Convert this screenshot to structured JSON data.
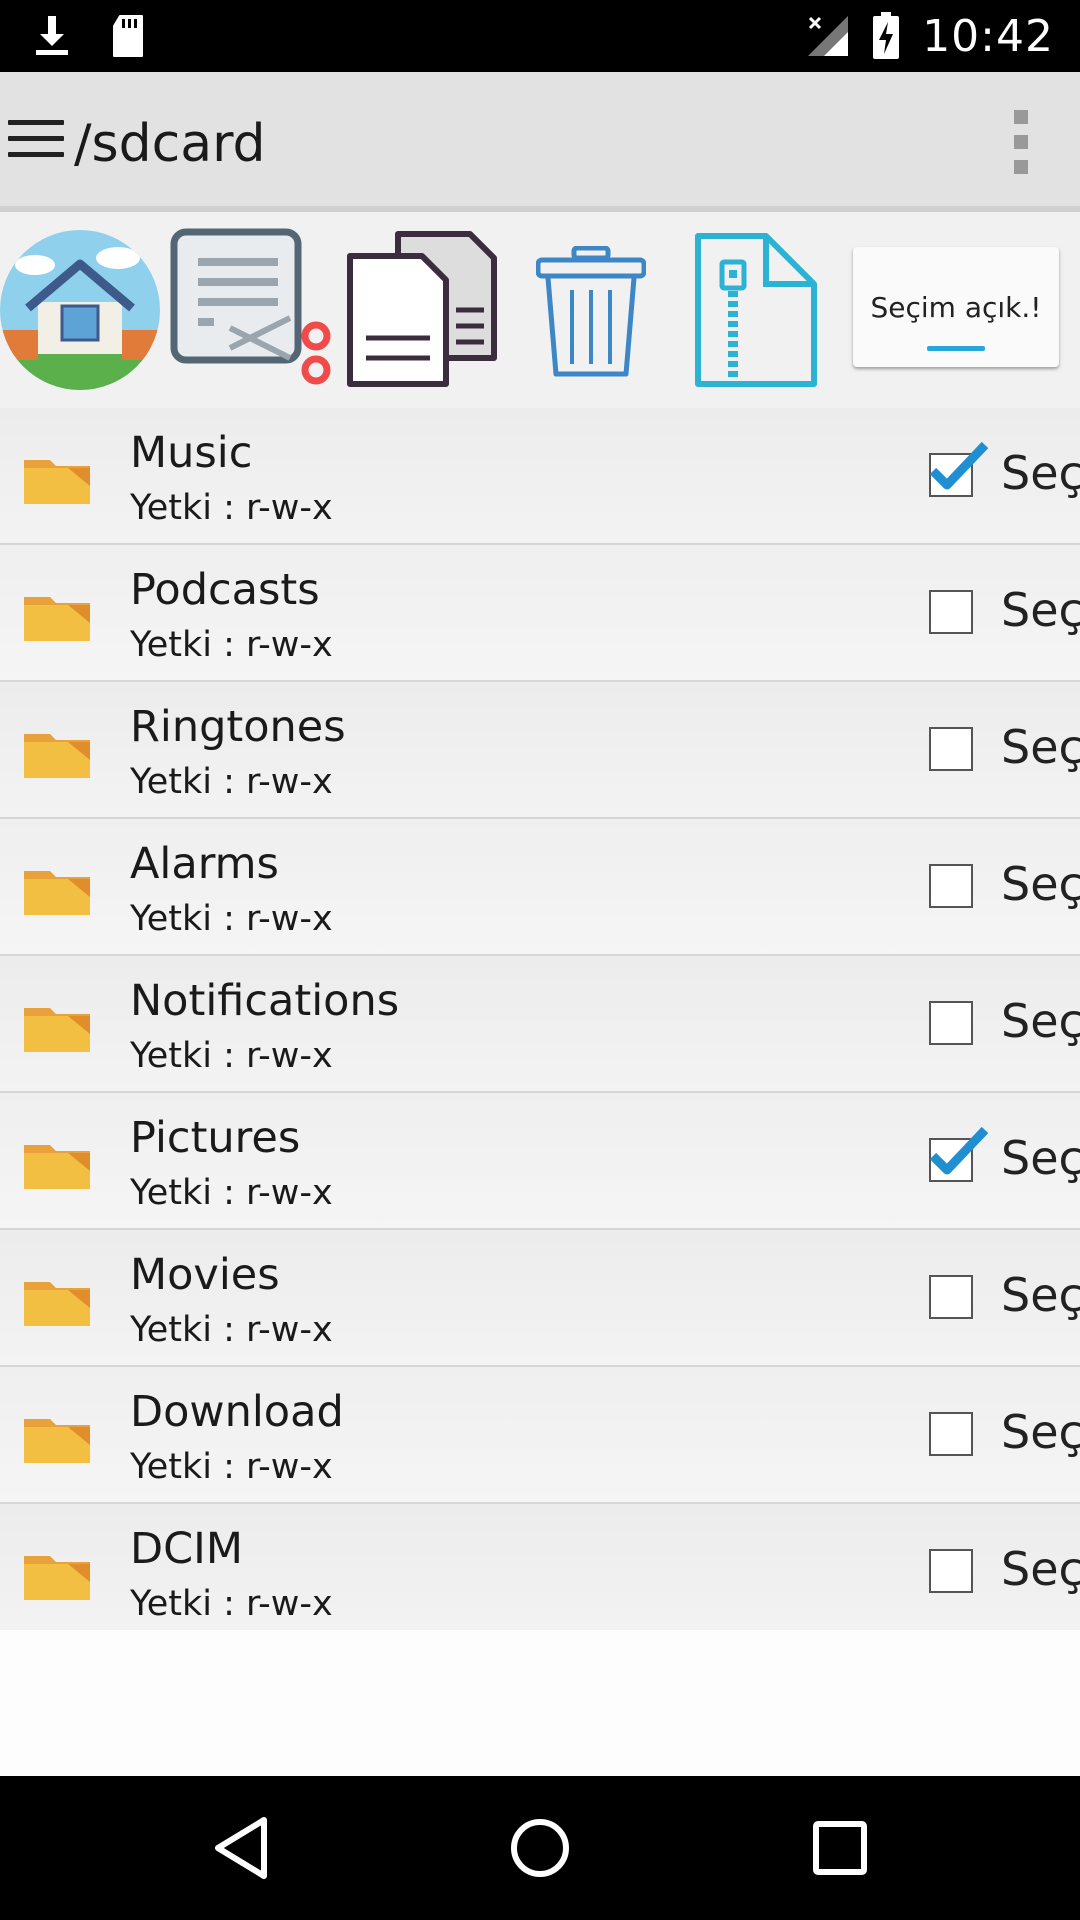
{
  "status_bar": {
    "time": "10:42",
    "icons": [
      "download-icon",
      "sd-card-icon",
      "signal-off-icon",
      "battery-charging-icon"
    ]
  },
  "app_bar": {
    "title": "/sdcard",
    "menu_icon": "hamburger-menu-icon",
    "overflow_icon": "overflow-menu-icon"
  },
  "toolbar": {
    "tools": [
      "home-icon",
      "cut-icon",
      "copy-icon",
      "delete-icon",
      "zip-icon"
    ],
    "select_button_label": "Seçim açık.!",
    "accent_color": "#29a6d9"
  },
  "list": {
    "checkbox_label": "Seç",
    "items": [
      {
        "name": "Music",
        "perm": "Yetki : r-w-x",
        "checked": true
      },
      {
        "name": "Podcasts",
        "perm": "Yetki : r-w-x",
        "checked": false
      },
      {
        "name": "Ringtones",
        "perm": "Yetki : r-w-x",
        "checked": false
      },
      {
        "name": "Alarms",
        "perm": "Yetki : r-w-x",
        "checked": false
      },
      {
        "name": "Notifications",
        "perm": "Yetki : r-w-x",
        "checked": false
      },
      {
        "name": "Pictures",
        "perm": "Yetki : r-w-x",
        "checked": true
      },
      {
        "name": "Movies",
        "perm": "Yetki : r-w-x",
        "checked": false
      },
      {
        "name": "Download",
        "perm": "Yetki : r-w-x",
        "checked": false
      },
      {
        "name": "DCIM",
        "perm": "Yetki : r-w-x",
        "checked": false
      }
    ]
  },
  "nav_bar": {
    "buttons": [
      "back-icon",
      "home-circle-icon",
      "recents-icon"
    ]
  }
}
